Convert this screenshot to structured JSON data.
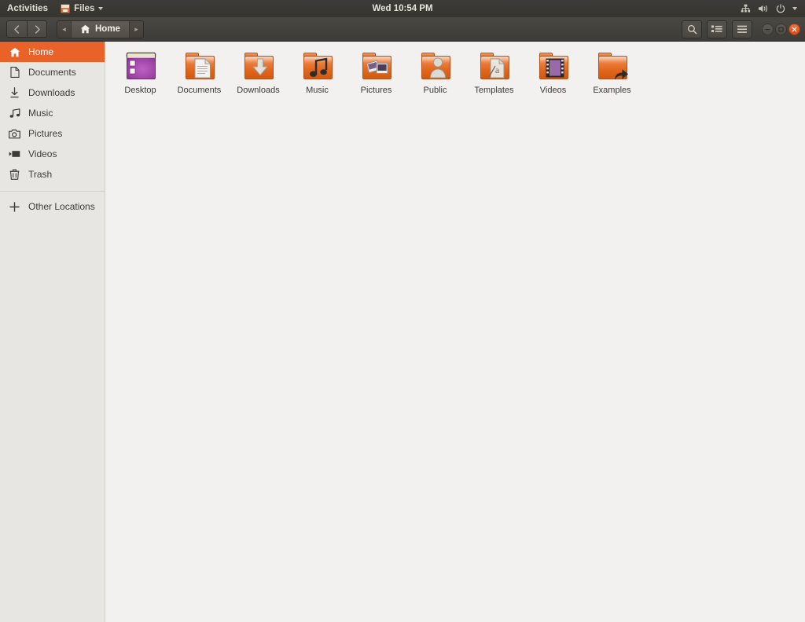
{
  "topbar": {
    "activities": "Activities",
    "app_menu": {
      "label": "Files",
      "icon": "files-icon",
      "caret": "chevron-down-icon"
    },
    "clock": "Wed 10:54 PM",
    "tray_icons": [
      "network-icon",
      "volume-icon",
      "power-icon",
      "chevron-down-icon"
    ]
  },
  "headerbar": {
    "back": "back-icon",
    "forward": "forward-icon",
    "breadcrumb": {
      "left_arrow": "◂",
      "label": "Home",
      "icon": "home-icon",
      "right_arrow": "▸"
    },
    "search": "search-icon",
    "view_toggle": "list-view-icon",
    "menu": "hamburger-menu-icon",
    "window_controls": {
      "minimize": "–",
      "maximize": "□",
      "close": "✕"
    }
  },
  "sidebar": {
    "items": [
      {
        "label": "Home",
        "icon": "home-icon",
        "active": true
      },
      {
        "label": "Documents",
        "icon": "document-icon",
        "active": false
      },
      {
        "label": "Downloads",
        "icon": "download-icon",
        "active": false
      },
      {
        "label": "Music",
        "icon": "music-icon",
        "active": false
      },
      {
        "label": "Pictures",
        "icon": "camera-icon",
        "active": false
      },
      {
        "label": "Videos",
        "icon": "video-icon",
        "active": false
      },
      {
        "label": "Trash",
        "icon": "trash-icon",
        "active": false
      }
    ],
    "other_locations": {
      "label": "Other Locations",
      "icon": "plus-icon"
    }
  },
  "files": [
    {
      "name": "Desktop",
      "type": "desktop-folder"
    },
    {
      "name": "Documents",
      "type": "documents-folder"
    },
    {
      "name": "Downloads",
      "type": "downloads-folder"
    },
    {
      "name": "Music",
      "type": "music-folder"
    },
    {
      "name": "Pictures",
      "type": "pictures-folder"
    },
    {
      "name": "Public",
      "type": "public-folder"
    },
    {
      "name": "Templates",
      "type": "templates-folder"
    },
    {
      "name": "Videos",
      "type": "videos-folder"
    },
    {
      "name": "Examples",
      "type": "link-folder"
    }
  ],
  "colors": {
    "ubuntu_orange": "#e8622a",
    "close_button": "#dd4814",
    "topbar_bg": "#36352f",
    "headerbar_bg": "#46443f",
    "sidebar_bg": "#e8e6e3",
    "content_bg": "#f2f1f0"
  }
}
